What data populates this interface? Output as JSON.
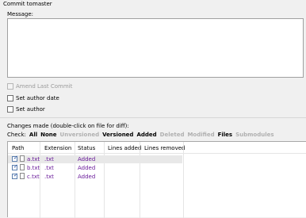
{
  "commit": {
    "label": "Commit to:",
    "branch": "master"
  },
  "message": {
    "label": "Message:",
    "value": ""
  },
  "options": {
    "amend": {
      "label": "Amend Last Commit",
      "checked": false,
      "enabled": false
    },
    "set_author_date": {
      "label": "Set author date",
      "checked": false,
      "enabled": true
    },
    "set_author": {
      "label": "Set author",
      "checked": false,
      "enabled": true
    }
  },
  "changes": {
    "label": "Changes made (double-click on file for diff):",
    "check_label": "Check:",
    "filters": [
      {
        "label": "All",
        "enabled": true
      },
      {
        "label": "None",
        "enabled": true
      },
      {
        "label": "Unversioned",
        "enabled": false
      },
      {
        "label": "Versioned",
        "enabled": true
      },
      {
        "label": "Added",
        "enabled": true
      },
      {
        "label": "Deleted",
        "enabled": false
      },
      {
        "label": "Modified",
        "enabled": false
      },
      {
        "label": "Files",
        "enabled": true
      },
      {
        "label": "Submodules",
        "enabled": false
      }
    ],
    "columns": [
      "Path",
      "Extension",
      "Status",
      "Lines added",
      "Lines removed"
    ],
    "files": [
      {
        "path": "a.txt",
        "extension": ".txt",
        "status": "Added",
        "checked": true,
        "selected": true
      },
      {
        "path": "b.txt",
        "extension": ".txt",
        "status": "Added",
        "checked": true,
        "selected": false
      },
      {
        "path": "c.txt",
        "extension": ".txt",
        "status": "Added",
        "checked": true,
        "selected": false
      }
    ]
  },
  "colors": {
    "file_text": "#6a1b9a",
    "disabled_text": "#b0b0b0"
  }
}
